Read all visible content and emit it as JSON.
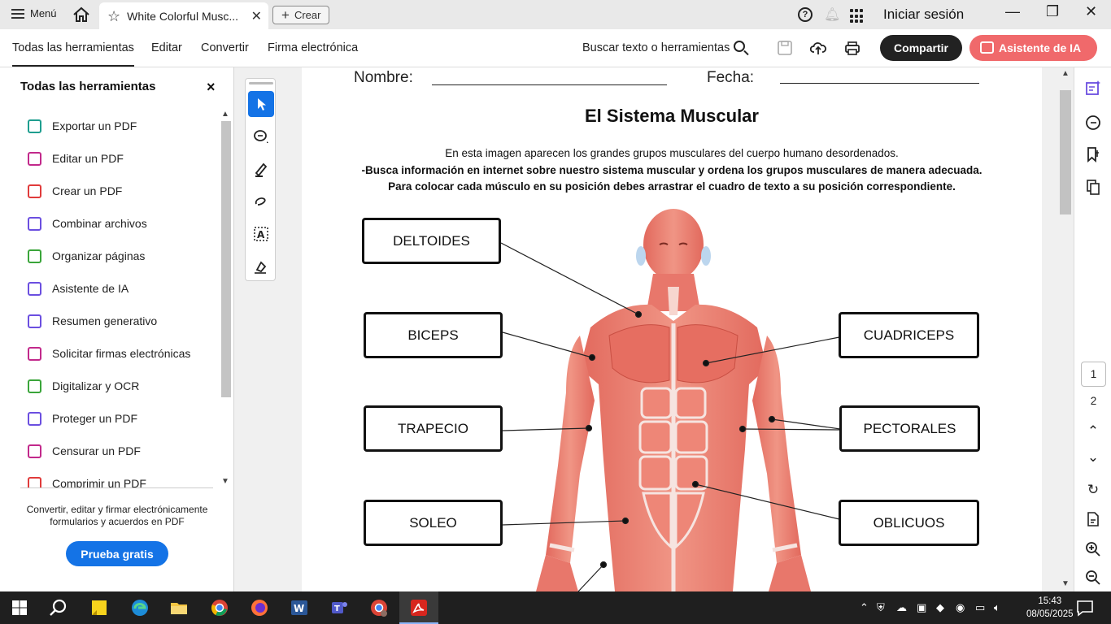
{
  "titlebar": {
    "menu_label": "Menú",
    "tab_title": "White Colorful Musc...",
    "create_label": "Crear",
    "signin_label": "Iniciar sesión"
  },
  "menubar": {
    "tabs": [
      "Todas las herramientas",
      "Editar",
      "Convertir",
      "Firma electrónica"
    ],
    "search_label": "Buscar texto o herramientas",
    "share_label": "Compartir",
    "ai_label": "Asistente de IA"
  },
  "tools_panel": {
    "title": "Todas las herramientas",
    "items": [
      {
        "label": "Exportar un PDF",
        "icon": "export-pdf-icon",
        "color": "#1e9e8f"
      },
      {
        "label": "Editar un PDF",
        "icon": "edit-pdf-icon",
        "color": "#c2298b"
      },
      {
        "label": "Crear un PDF",
        "icon": "create-pdf-icon",
        "color": "#e03b3b"
      },
      {
        "label": "Combinar archivos",
        "icon": "combine-files-icon",
        "color": "#6b4fe0"
      },
      {
        "label": "Organizar páginas",
        "icon": "organize-pages-icon",
        "color": "#3aa53a"
      },
      {
        "label": "Asistente de IA",
        "icon": "ai-assistant-icon",
        "color": "#6b4fe0"
      },
      {
        "label": "Resumen generativo",
        "icon": "generative-summary-icon",
        "color": "#6b4fe0"
      },
      {
        "label": "Solicitar firmas electrónicas",
        "icon": "request-signatures-icon",
        "color": "#c2298b"
      },
      {
        "label": "Digitalizar y OCR",
        "icon": "scan-ocr-icon",
        "color": "#3aa53a"
      },
      {
        "label": "Proteger un PDF",
        "icon": "protect-pdf-icon",
        "color": "#6b4fe0"
      },
      {
        "label": "Censurar un PDF",
        "icon": "redact-pdf-icon",
        "color": "#c2298b"
      },
      {
        "label": "Comprimir un PDF",
        "icon": "compress-pdf-icon",
        "color": "#e03b3b"
      }
    ],
    "promo_text": "Convertir, editar y firmar electrónicamente formularios y acuerdos en PDF",
    "trial_label": "Prueba gratis"
  },
  "document": {
    "name_label": "Nombre:",
    "date_label": "Fecha:",
    "title": "El Sistema Muscular",
    "instruction_1": "En esta imagen aparecen los grandes grupos musculares del cuerpo humano desordenados.",
    "instruction_2": "-Busca información en internet sobre nuestro sistema muscular y ordena los grupos musculares de manera adecuada.",
    "instruction_3": "Para colocar cada músculo en su posición debes arrastrar el cuadro de texto a su posición correspondiente.",
    "labels_left": [
      "DELTOIDES",
      "BICEPS",
      "TRAPECIO",
      "SOLEO"
    ],
    "labels_right": [
      "CUADRICEPS",
      "PECTORALES",
      "OBLICUOS"
    ]
  },
  "right_rail": {
    "pages": [
      "1",
      "2"
    ],
    "current_page": "1"
  },
  "taskbar": {
    "time": "15:43",
    "date": "08/05/2025"
  },
  "colors": {
    "accent_blue": "#1473e6",
    "ai_button": "#f0696b",
    "share_button": "#222222",
    "muscle": "#e8776b"
  }
}
